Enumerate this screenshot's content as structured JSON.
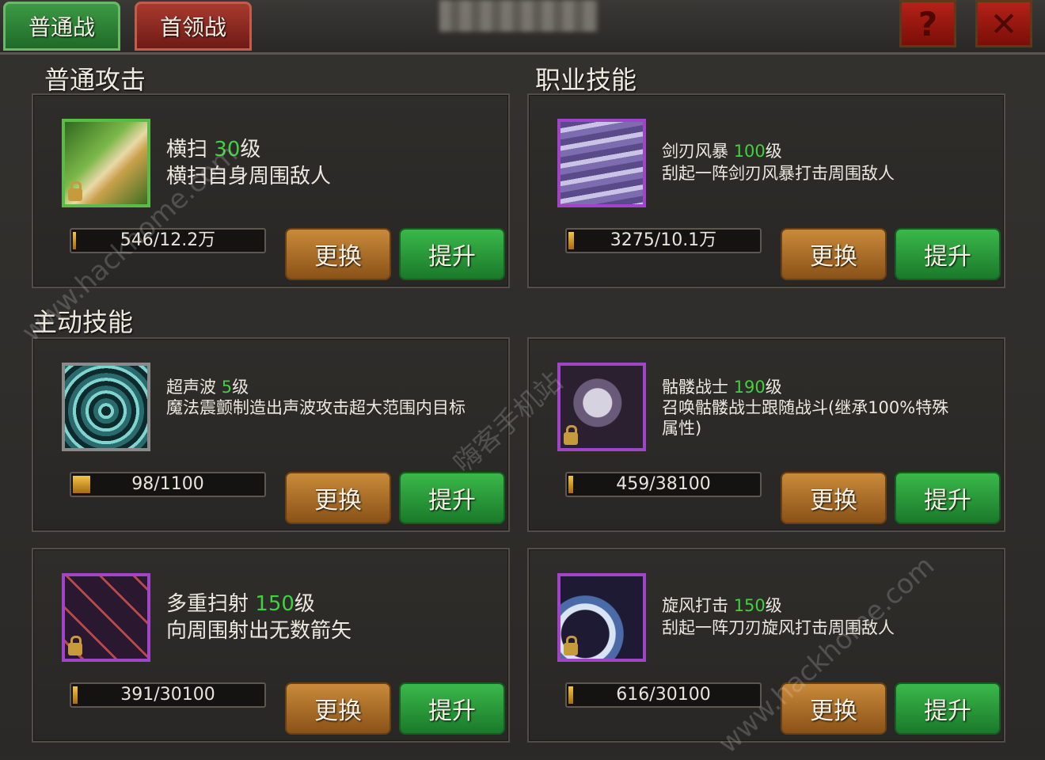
{
  "tabs": [
    {
      "label": "普通战",
      "active": true,
      "color": "#2f8a3b"
    },
    {
      "label": "首领战",
      "active": false,
      "color": "#9a2f25"
    }
  ],
  "window": {
    "help_label": "?",
    "close_label": "✕"
  },
  "sections": {
    "normal_attack": "普通攻击",
    "class_skill": "职业技能",
    "active_skill": "主动技能"
  },
  "buttons": {
    "swap": "更换",
    "upgrade": "提升"
  },
  "skills": [
    {
      "name": "横扫",
      "level": "30",
      "level_suffix": "级",
      "desc": "横扫自身周围敌人",
      "progress": "546/12.2万",
      "progress_frac": 0.0,
      "frame": "green",
      "locked": true,
      "icon": "sweep-icon"
    },
    {
      "name": "剑刃风暴",
      "level": "100",
      "level_suffix": "级",
      "desc": "刮起一阵剑刃风暴打击周围敌人",
      "progress": "3275/10.1万",
      "progress_frac": 0.03,
      "frame": "purple",
      "locked": false,
      "icon": "blade-storm-icon"
    },
    {
      "name": "超声波",
      "level": "5",
      "level_suffix": "级",
      "desc": "魔法震颤制造出声波攻击超大范围内目标",
      "progress": "98/1100",
      "progress_frac": 0.09,
      "frame": "gray",
      "locked": false,
      "icon": "sonic-wave-icon"
    },
    {
      "name": "骷髅战士",
      "level": "190",
      "level_suffix": "级",
      "desc": "召唤骷髅战士跟随战斗(继承100%特殊属性)",
      "progress": "459/38100",
      "progress_frac": 0.01,
      "frame": "purple",
      "locked": true,
      "icon": "skeleton-warrior-icon"
    },
    {
      "name": "多重扫射",
      "level": "150",
      "level_suffix": "级",
      "desc": "向周围射出无数箭矢",
      "progress": "391/30100",
      "progress_frac": 0.01,
      "frame": "purple",
      "locked": true,
      "icon": "multi-shot-icon"
    },
    {
      "name": "旋风打击",
      "level": "150",
      "level_suffix": "级",
      "desc": "刮起一阵刀刃旋风打击周围敌人",
      "progress": "616/30100",
      "progress_frac": 0.02,
      "frame": "purple",
      "locked": true,
      "icon": "whirlwind-strike-icon"
    }
  ],
  "watermarks": [
    "www.hackhome.com",
    "嗨客手机站",
    "www.hackhome.com"
  ]
}
